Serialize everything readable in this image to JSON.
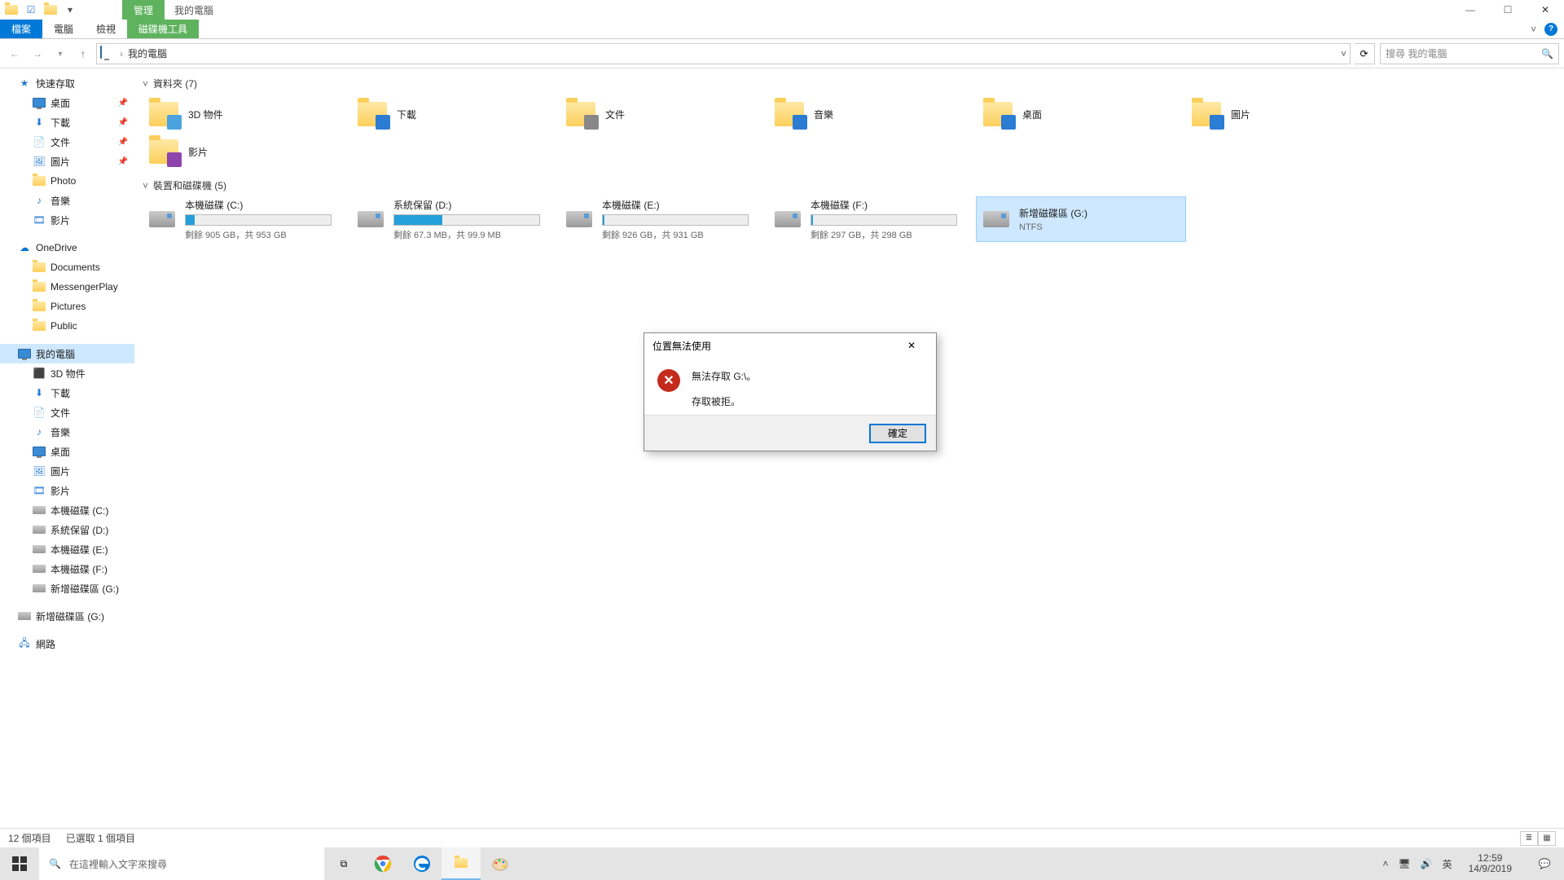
{
  "window": {
    "title": "我的電腦",
    "context_tab": "管理",
    "ribbon": {
      "file": "檔案",
      "computer": "電腦",
      "view": "檢視",
      "drive_tools": "磁碟機工具"
    },
    "sys": {
      "minimize": "—",
      "maximize": "☐",
      "close": "✕"
    }
  },
  "address": {
    "path": "我的電腦",
    "search_placeholder": "搜尋 我的電腦"
  },
  "sidebar": {
    "quick": "快速存取",
    "quick_items": [
      {
        "label": "桌面",
        "pin": true
      },
      {
        "label": "下載",
        "pin": true
      },
      {
        "label": "文件",
        "pin": true
      },
      {
        "label": "圖片",
        "pin": true
      },
      {
        "label": "Photo",
        "pin": false
      },
      {
        "label": "音樂",
        "pin": false
      },
      {
        "label": "影片",
        "pin": false
      }
    ],
    "onedrive": "OneDrive",
    "onedrive_items": [
      "Documents",
      "MessengerPlay",
      "Pictures",
      "Public"
    ],
    "thispc": "我的電腦",
    "thispc_items": [
      "3D 物件",
      "下載",
      "文件",
      "音樂",
      "桌面",
      "圖片",
      "影片",
      "本機磁碟 (C:)",
      "系統保留 (D:)",
      "本機磁碟 (E:)",
      "本機磁碟 (F:)",
      "新增磁碟區 (G:)"
    ],
    "extra_g": "新增磁碟區 (G:)",
    "network": "網路"
  },
  "groups": {
    "folders_header": "資料夾 (7)",
    "drives_header": "裝置和磁碟機 (5)"
  },
  "folders": [
    "3D 物件",
    "下載",
    "文件",
    "音樂",
    "桌面",
    "圖片",
    "影片"
  ],
  "drives": [
    {
      "name": "本機磁碟 (C:)",
      "sub": "剩餘 905 GB，共 953 GB",
      "pct": 6
    },
    {
      "name": "系統保留 (D:)",
      "sub": "剩餘 67.3 MB，共 99.9 MB",
      "pct": 33
    },
    {
      "name": "本機磁碟 (E:)",
      "sub": "剩餘 926 GB，共 931 GB",
      "pct": 1
    },
    {
      "name": "本機磁碟 (F:)",
      "sub": "剩餘 297 GB，共 298 GB",
      "pct": 1
    },
    {
      "name": "新增磁碟區 (G:)",
      "sub": "NTFS",
      "pct": null,
      "selected": true
    }
  ],
  "dialog": {
    "title": "位置無法使用",
    "line1": "無法存取 G:\\。",
    "line2": "存取被拒。",
    "ok": "確定"
  },
  "status": {
    "items": "12 個項目",
    "selected": "已選取 1 個項目"
  },
  "taskbar": {
    "search_placeholder": "在這裡輸入文字來搜尋",
    "ime": "英",
    "time": "12:59",
    "date": "14/9/2019"
  }
}
